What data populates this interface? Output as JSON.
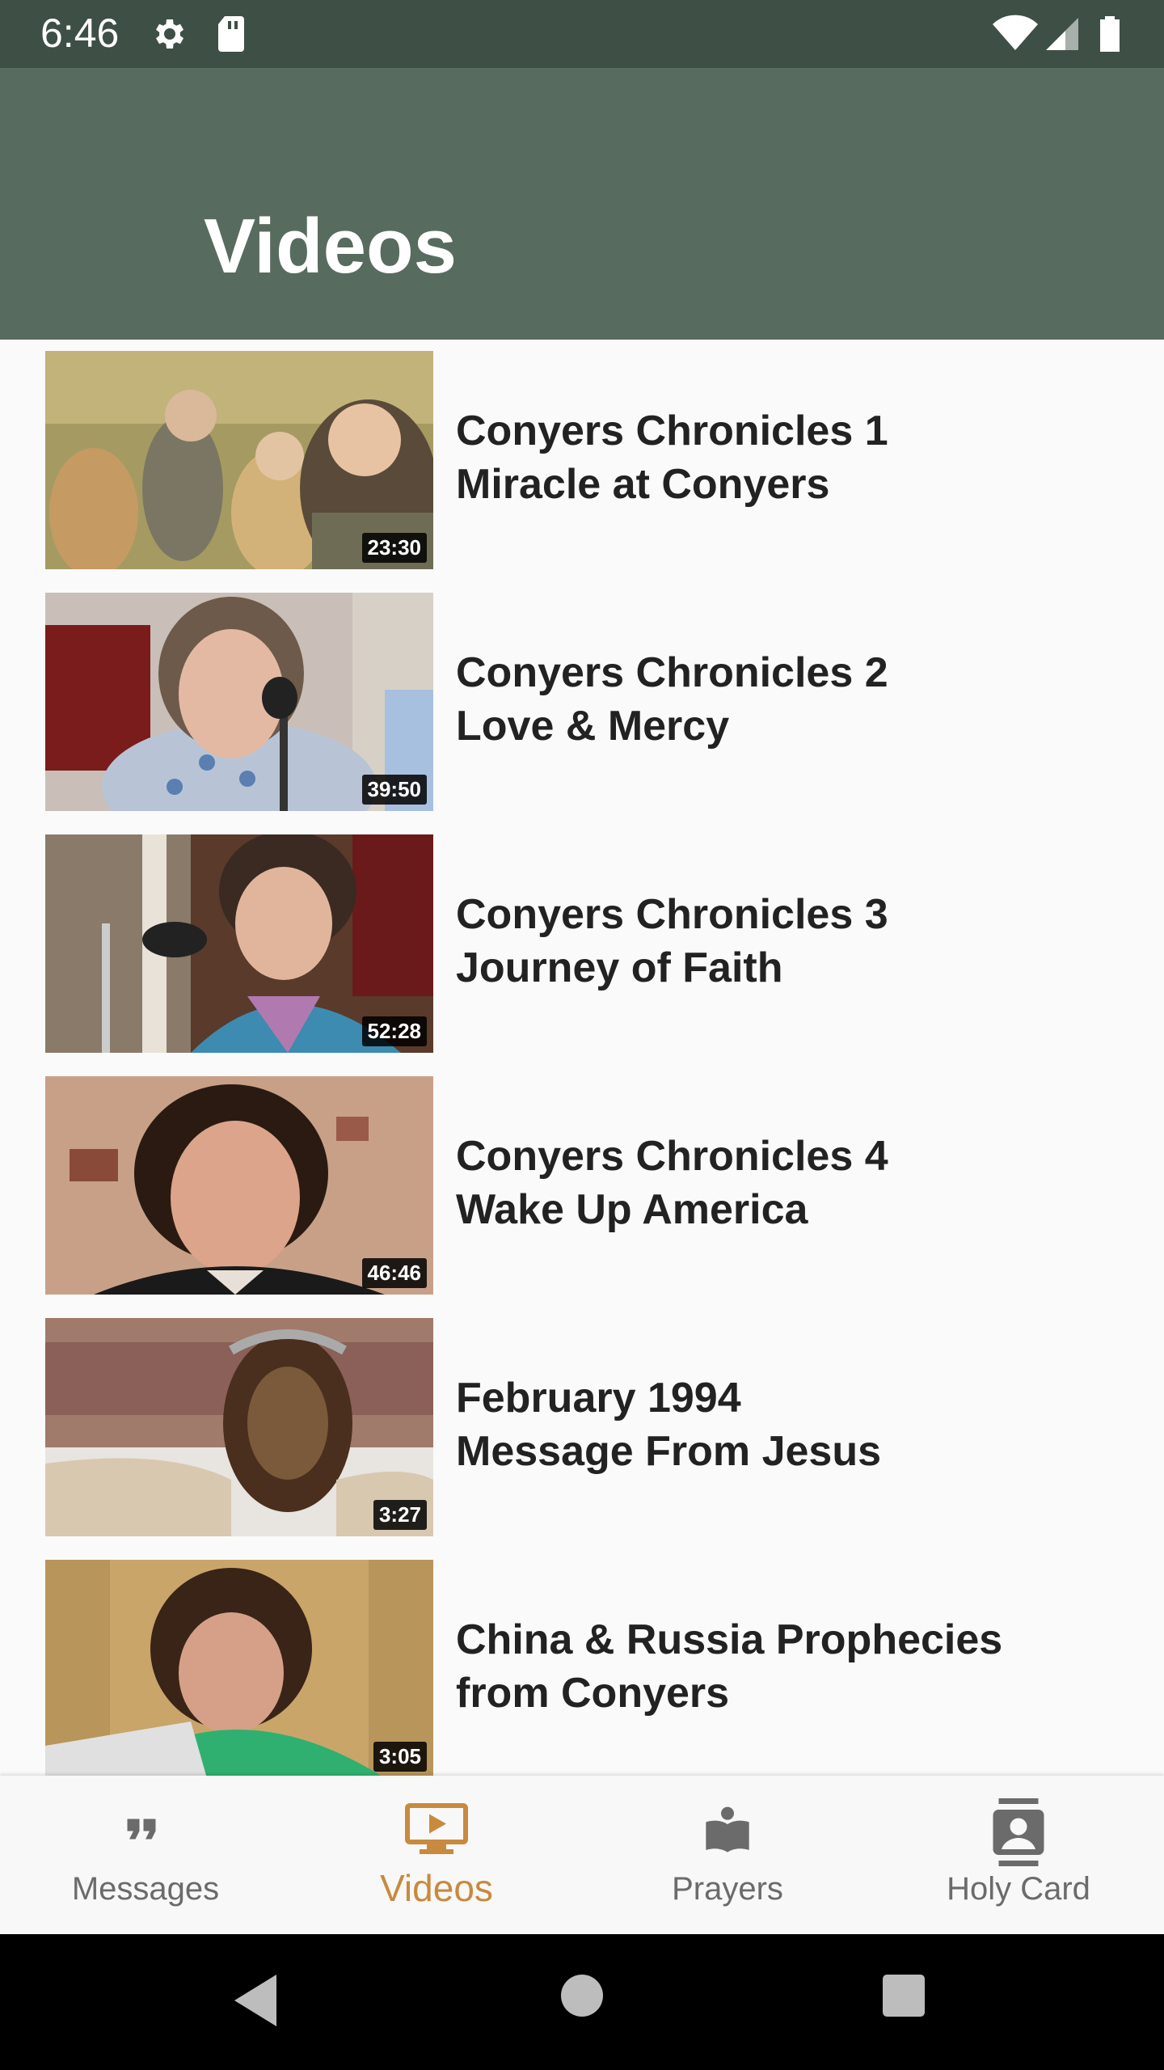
{
  "status_bar": {
    "time": "6:46",
    "icons": [
      "settings-icon",
      "sd-card-icon",
      "wifi-icon",
      "signal-icon",
      "battery-icon"
    ]
  },
  "app_bar": {
    "title": "Videos"
  },
  "videos": [
    {
      "line1": "Conyers Chronicles 1",
      "line2": "Miracle at Conyers",
      "duration": "23:30"
    },
    {
      "line1": "Conyers Chronicles 2",
      "line2": "Love & Mercy",
      "duration": "39:50"
    },
    {
      "line1": "Conyers Chronicles 3",
      "line2": "Journey of Faith",
      "duration": "52:28"
    },
    {
      "line1": "Conyers Chronicles 4",
      "line2": "Wake Up America",
      "duration": "46:46"
    },
    {
      "line1": "February 1994",
      "line2": "Message From Jesus",
      "duration": "3:27"
    },
    {
      "line1": "China & Russia Prophecies",
      "line2": "from Conyers",
      "duration": "3:05"
    }
  ],
  "bottom_nav": {
    "items": [
      {
        "label": "Messages",
        "icon": "quote-icon",
        "active": false
      },
      {
        "label": "Videos",
        "icon": "video-icon",
        "active": true
      },
      {
        "label": "Prayers",
        "icon": "book-reader-icon",
        "active": false
      },
      {
        "label": "Holy Card",
        "icon": "contact-card-icon",
        "active": false
      }
    ]
  },
  "colors": {
    "status_bar": "#3e4f45",
    "app_bar": "#586b5f",
    "accent": "#c88a3e",
    "nav_inactive": "#6b6b6b"
  }
}
